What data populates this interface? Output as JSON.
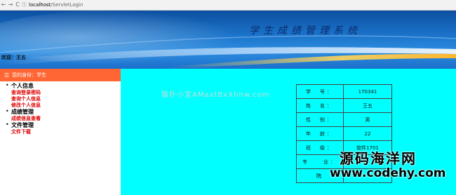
{
  "browser": {
    "back": "←",
    "forward": "→",
    "reload": "C",
    "info": "ⓘ",
    "url_host": "localhost",
    "url_path": "/ServletLogin"
  },
  "banner": {
    "title": "学生成绩管理系统",
    "welcome": "欢迎：王五"
  },
  "sidebar": {
    "header_icon": "☰",
    "header": "您的身份：学生",
    "groups": [
      {
        "title": "个人信息",
        "items": [
          "查询登录密码",
          "查询个人信息",
          "修改个人信息"
        ]
      },
      {
        "title": "成绩管理",
        "items": [
          "成绩信息查看"
        ]
      },
      {
        "title": "文件管理",
        "items": [
          "文件下载"
        ]
      }
    ]
  },
  "main": {
    "watermark": "猫扑小宝AMaxtBxXhhw.com",
    "rows": [
      {
        "key": "学　号：",
        "value": "170341"
      },
      {
        "key": "姓　名：",
        "value": "王五"
      },
      {
        "key": "性　别：",
        "value": "男"
      },
      {
        "key": "年　龄：",
        "value": "22"
      },
      {
        "key": "班　级：",
        "value": "软件1701"
      },
      {
        "key": "专　　业：",
        "value": ""
      },
      {
        "key": "院",
        "value": ""
      }
    ]
  },
  "overlay": {
    "cn": "源码海洋网",
    "en": "www.codehy.com"
  }
}
